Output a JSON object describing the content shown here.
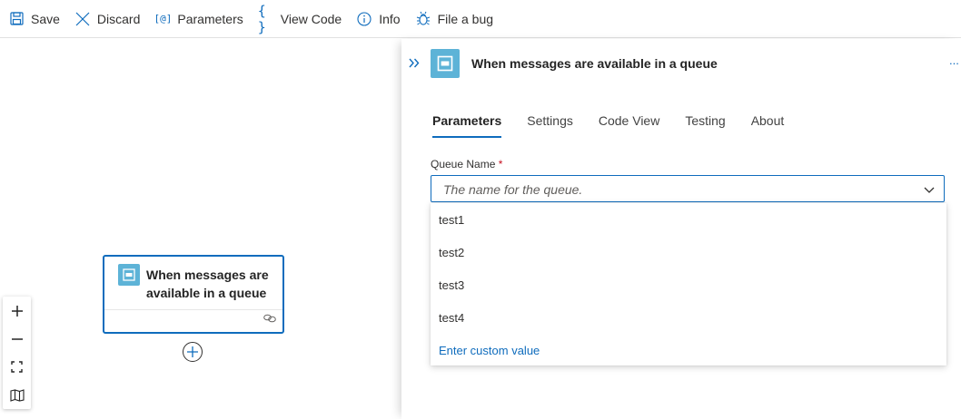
{
  "toolbar": {
    "save": "Save",
    "discard": "Discard",
    "parameters_icon": "[@]",
    "parameters": "Parameters",
    "view_code_icon": "{ }",
    "view_code": "View Code",
    "info": "Info",
    "file_bug": "File a bug"
  },
  "canvas": {
    "node_title": "When messages are available in a queue",
    "node_icon": "queue-icon",
    "zoom_controls": [
      "zoom-in-icon",
      "zoom-out-icon",
      "fit-view-icon",
      "minimap-icon"
    ]
  },
  "panel": {
    "title": "When messages are available in a queue",
    "more": "...",
    "tabs": [
      "Parameters",
      "Settings",
      "Code View",
      "Testing",
      "About"
    ],
    "active_tab": "Parameters",
    "field_label": "Queue Name",
    "required_mark": "*",
    "field_placeholder": "The name for the queue.",
    "options": [
      "test1",
      "test2",
      "test3",
      "test4"
    ],
    "custom_option": "Enter custom value"
  },
  "colors": {
    "accent": "#0f6cbd",
    "icon_bg": "#5db3d7",
    "required": "#c50f1f"
  }
}
